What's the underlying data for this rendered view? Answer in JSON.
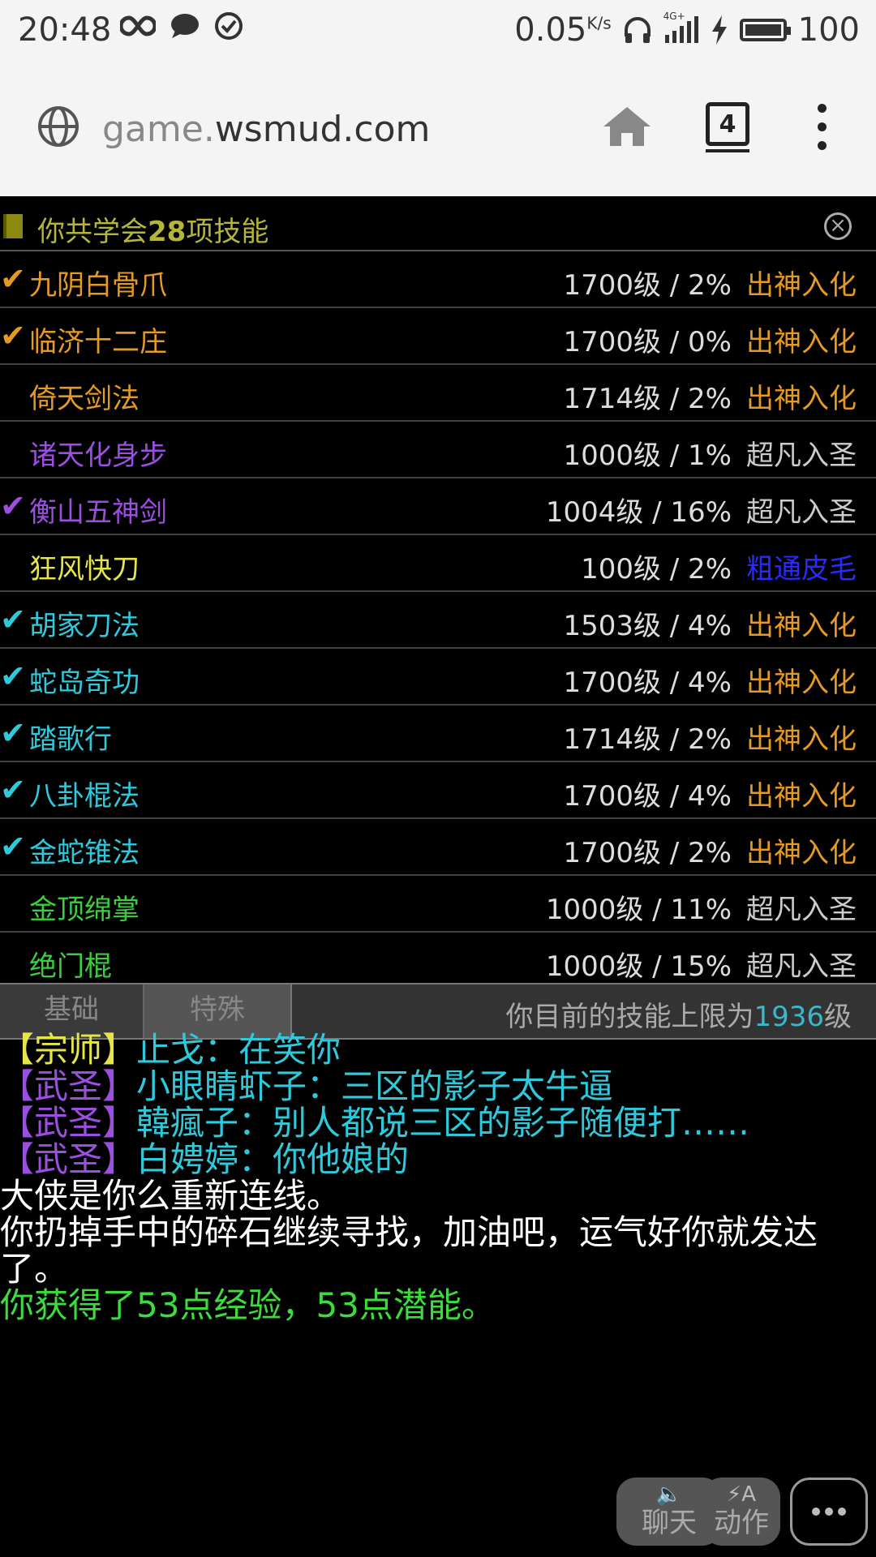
{
  "status_bar": {
    "time": "20:48",
    "speed": "0.05",
    "speed_unit": "K/s",
    "network": "4G+",
    "battery": "100",
    "battery_level": 1.0
  },
  "browser": {
    "url_prefix": "game.",
    "url_host": "wsmud.com",
    "tab_count": "4"
  },
  "skills_panel": {
    "title_prefix": "你共学会",
    "title_count": "28",
    "title_suffix": "项技能",
    "skills": [
      {
        "check": "✔",
        "name": "九阴白骨爪",
        "level": "1700级 / 2%",
        "rank": "出神入化",
        "name_color": "#e59a24",
        "check_color": "#e59a24",
        "rank_color": "#e59a24"
      },
      {
        "check": "✔",
        "name": "临济十二庄",
        "level": "1700级 / 0%",
        "rank": "出神入化",
        "name_color": "#e59a24",
        "check_color": "#e59a24",
        "rank_color": "#e59a24"
      },
      {
        "check": "",
        "name": "倚天剑法",
        "level": "1714级 / 2%",
        "rank": "出神入化",
        "name_color": "#e59a24",
        "check_color": "#e59a24",
        "rank_color": "#e59a24"
      },
      {
        "check": "",
        "name": "诸天化身步",
        "level": "1000级 / 1%",
        "rank": "超凡入圣",
        "name_color": "#9a4fe0",
        "check_color": "#9a4fe0",
        "rank_color": "#cccccc"
      },
      {
        "check": "✔",
        "name": "衡山五神剑",
        "level": "1004级 / 16%",
        "rank": "超凡入圣",
        "name_color": "#9a4fe0",
        "check_color": "#9a4fe0",
        "rank_color": "#cccccc"
      },
      {
        "check": "",
        "name": "狂风快刀",
        "level": "100级 / 2%",
        "rank": "粗通皮毛",
        "name_color": "#e5e54a",
        "check_color": "#e5e54a",
        "rank_color": "#2a2aff"
      },
      {
        "check": "✔",
        "name": "胡家刀法",
        "level": "1503级 / 4%",
        "rank": "出神入化",
        "name_color": "#2fc9dc",
        "check_color": "#2fc9dc",
        "rank_color": "#e59a24"
      },
      {
        "check": "✔",
        "name": "蛇岛奇功",
        "level": "1700级 / 4%",
        "rank": "出神入化",
        "name_color": "#2fc9dc",
        "check_color": "#2fc9dc",
        "rank_color": "#e59a24"
      },
      {
        "check": "✔",
        "name": "踏歌行",
        "level": "1714级 / 2%",
        "rank": "出神入化",
        "name_color": "#2fc9dc",
        "check_color": "#2fc9dc",
        "rank_color": "#e59a24"
      },
      {
        "check": "✔",
        "name": "八卦棍法",
        "level": "1700级 / 4%",
        "rank": "出神入化",
        "name_color": "#2fc9dc",
        "check_color": "#2fc9dc",
        "rank_color": "#e59a24"
      },
      {
        "check": "✔",
        "name": "金蛇锥法",
        "level": "1700级 / 2%",
        "rank": "出神入化",
        "name_color": "#2fc9dc",
        "check_color": "#2fc9dc",
        "rank_color": "#e59a24"
      },
      {
        "check": "",
        "name": "金顶绵掌",
        "level": "1000级 / 11%",
        "rank": "超凡入圣",
        "name_color": "#3ccf3c",
        "check_color": "#3ccf3c",
        "rank_color": "#cccccc"
      },
      {
        "check": "",
        "name": "绝门棍",
        "level": "1000级 / 15%",
        "rank": "超凡入圣",
        "name_color": "#3ccf3c",
        "check_color": "#3ccf3c",
        "rank_color": "#cccccc"
      }
    ]
  },
  "tabs": {
    "basic": "基础",
    "special": "特殊",
    "limit_prefix": "你目前的技能上限为",
    "limit_value": "1936",
    "limit_suffix": "级"
  },
  "chat": [
    {
      "title": "【宗师】",
      "title_color": "#e5e54a",
      "text": "止戈：在笑你",
      "text_color": "#2fc9dc"
    },
    {
      "title": "【武圣】",
      "title_color": "#9a4fe0",
      "text": "小眼睛虾子：三区的影子太牛逼",
      "text_color": "#2fc9dc"
    },
    {
      "title": "【武圣】",
      "title_color": "#9a4fe0",
      "text": "韓瘋子：别人都说三区的影子随便打……",
      "text_color": "#2fc9dc"
    },
    {
      "title": "【武圣】",
      "title_color": "#9a4fe0",
      "text": "白娉婷：你他娘的",
      "text_color": "#2fc9dc"
    }
  ],
  "messages": [
    {
      "text": "大侠是你么重新连线。",
      "color": "#ffffff"
    },
    {
      "text": "你扔掉手中的碎石继续寻找，加油吧，运气好你就发达了。",
      "color": "#ffffff"
    },
    {
      "text": "你获得了53点经验，53点潜能。",
      "color": "#3cdc3c"
    }
  ],
  "buttons": {
    "chat": "聊天",
    "action": "动作",
    "action_icon": "A"
  }
}
